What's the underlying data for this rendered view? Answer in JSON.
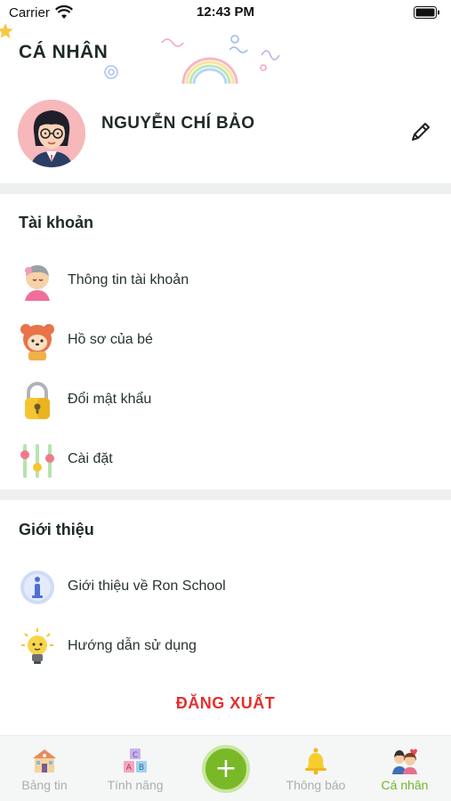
{
  "status_bar": {
    "carrier": "Carrier",
    "time": "12:43 PM"
  },
  "header": {
    "title": "CÁ NHÂN"
  },
  "profile": {
    "name": "NGUYỄN CHÍ BẢO"
  },
  "account_section": {
    "title": "Tài khoản",
    "items": [
      {
        "label": "Thông tin tài khoản",
        "icon": "user-info-icon"
      },
      {
        "label": "Hồ sơ của bé",
        "icon": "bear-profile-icon"
      },
      {
        "label": "Đổi mật khẩu",
        "icon": "padlock-icon"
      },
      {
        "label": "Cài đặt",
        "icon": "sliders-icon"
      }
    ]
  },
  "about_section": {
    "title": "Giới thiệu",
    "items": [
      {
        "label": "Giới thiệu về Ron School",
        "icon": "info-icon"
      },
      {
        "label": "Hướng dẫn sử dụng",
        "icon": "lightbulb-icon"
      }
    ]
  },
  "logout_label": "ĐĂNG XUẤT",
  "tabbar": {
    "tabs": [
      {
        "label": "Bảng tin",
        "icon": "school-house-icon"
      },
      {
        "label": "Tính năng",
        "icon": "abc-blocks-icon"
      },
      {
        "label": "+",
        "icon": "plus-icon"
      },
      {
        "label": "Thông báo",
        "icon": "bell-icon"
      },
      {
        "label": "Cá nhân",
        "icon": "family-icon"
      }
    ],
    "active": "Cá nhân"
  },
  "colors": {
    "accent_green": "#79b928",
    "logout_red": "#e2302d",
    "divider": "#eef0ef"
  }
}
